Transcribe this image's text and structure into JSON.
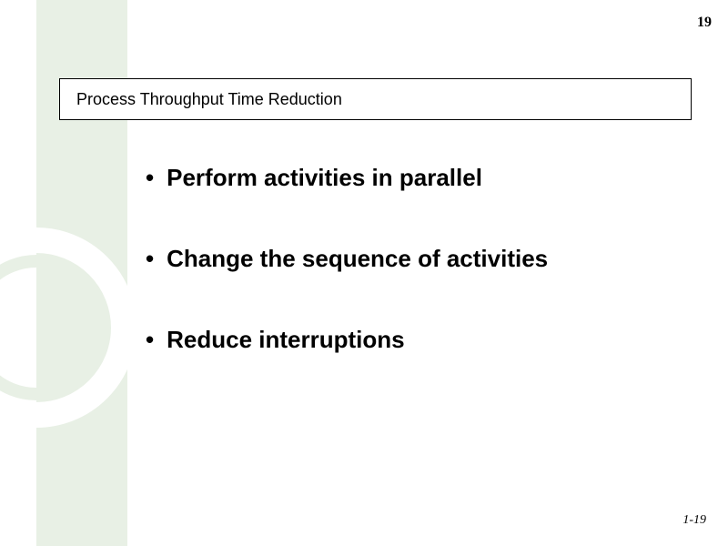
{
  "page_number_top": "19",
  "title": "Process Throughput Time Reduction",
  "bullets": [
    "Perform activities in parallel",
    "Change the sequence of activities",
    "Reduce interruptions"
  ],
  "page_number_bottom": "1-19"
}
